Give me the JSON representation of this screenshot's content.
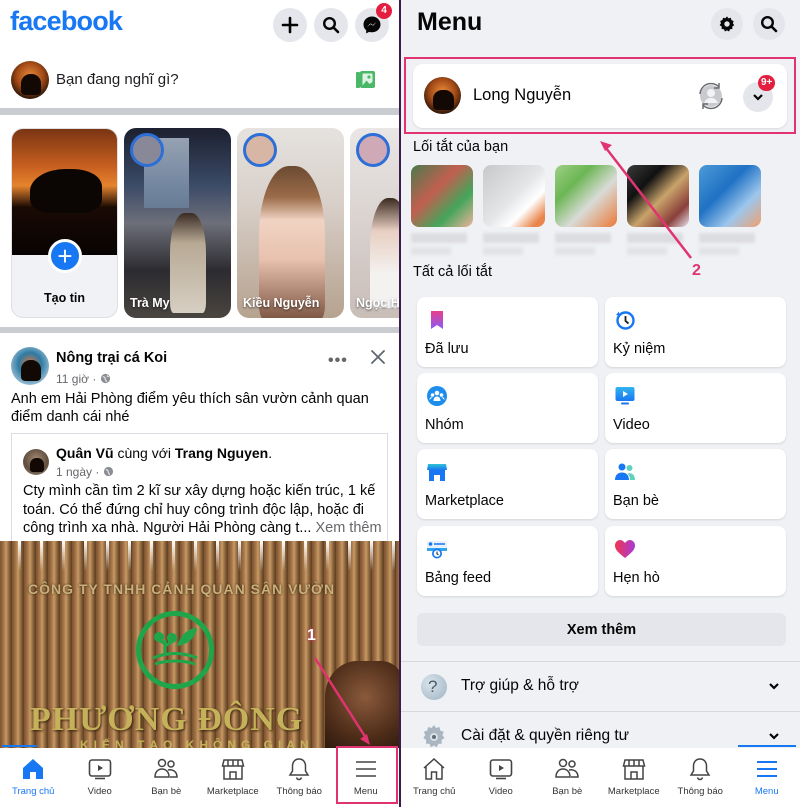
{
  "left_screen": {
    "header": {
      "logo": "facebook",
      "messenger_badge": "4"
    },
    "composer": {
      "placeholder": "Bạn đang nghĩ gì?"
    },
    "stories": [
      {
        "label": "Tạo tin",
        "type": "create"
      },
      {
        "label": "Trà My"
      },
      {
        "label": "Kiều Nguyễn"
      },
      {
        "label": "Ngọc Hà"
      }
    ],
    "post": {
      "author": "Nông trại cá Koi",
      "time": "11 giờ · ",
      "text": "Anh em Hải Phòng điểm yêu thích sân vườn cảnh quan điểm danh cái nhé",
      "shared": {
        "author": "Quân Vũ",
        "with_text": " cùng với ",
        "tagged": "Trang Nguyen",
        "suffix": ".",
        "time": "1 ngày · ",
        "text": "Cty mình cần tìm 2 kĩ sư xây dựng hoặc kiến trúc, 1 kế toán. Có thể  đứng chỉ huy công trình độc lập, hoặc đi công trình xa nhà. Người Hải Phòng càng t...",
        "see_more": "Xem thêm"
      },
      "image_text": {
        "company": "CÔNG TY TNHH CẢNH QUAN SÂN VƯỜN",
        "brand": "PHƯƠNG ĐÔNG",
        "tagline": "KIẾN TẠO KHÔNG GIAN"
      }
    },
    "annotation": "1",
    "bottom_nav": [
      {
        "label": "Trang chủ",
        "icon": "home-icon",
        "active": true
      },
      {
        "label": "Video",
        "icon": "video-icon"
      },
      {
        "label": "Bạn bè",
        "icon": "friends-icon"
      },
      {
        "label": "Marketplace",
        "icon": "marketplace-icon"
      },
      {
        "label": "Thông báo",
        "icon": "bell-icon"
      },
      {
        "label": "Menu",
        "icon": "menu-icon",
        "highlighted": true
      }
    ]
  },
  "right_screen": {
    "title": "Menu",
    "profile": {
      "name": "Long Nguyễn",
      "notification_badge": "9+"
    },
    "annotation": "2",
    "shortcuts_label": "Lối tắt của bạn",
    "all_shortcuts_label": "Tất cả lối tắt",
    "tiles": [
      {
        "label": "Đã lưu",
        "icon": "bookmark-icon"
      },
      {
        "label": "Kỷ niệm",
        "icon": "memories-clock-icon"
      },
      {
        "label": "Nhóm",
        "icon": "groups-icon"
      },
      {
        "label": "Video",
        "icon": "video-icon"
      },
      {
        "label": "Marketplace",
        "icon": "marketplace-icon"
      },
      {
        "label": "Bạn bè",
        "icon": "friends-icon"
      },
      {
        "label": "Bảng feed",
        "icon": "feeds-icon"
      },
      {
        "label": "Hẹn hò",
        "icon": "dating-heart-icon"
      }
    ],
    "see_more": "Xem thêm",
    "accordions": [
      {
        "label": "Trợ giúp & hỗ trợ",
        "icon": "help-icon"
      },
      {
        "label": "Cài đặt & quyền riêng tư",
        "icon": "settings-gear-icon"
      }
    ],
    "bottom_nav": [
      {
        "label": "Trang chủ",
        "icon": "home-icon"
      },
      {
        "label": "Video",
        "icon": "video-icon"
      },
      {
        "label": "Bạn bè",
        "icon": "friends-icon"
      },
      {
        "label": "Marketplace",
        "icon": "marketplace-icon"
      },
      {
        "label": "Thông báo",
        "icon": "bell-icon"
      },
      {
        "label": "Menu",
        "icon": "menu-icon",
        "active": true
      }
    ]
  },
  "colors": {
    "brand_blue": "#1877f2",
    "badge_red": "#e41e3f",
    "annotation_pink": "#e0336f",
    "menu_bg": "#eff1f5"
  }
}
